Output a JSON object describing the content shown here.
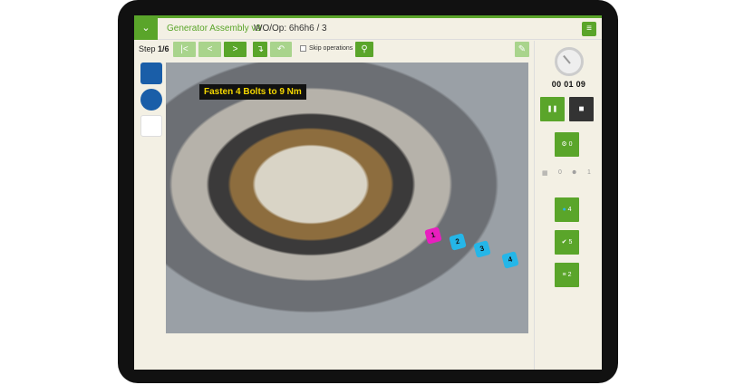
{
  "header": {
    "title": "Generator Assembly v9",
    "wo": "WO/Op: 6h6h6 / 3"
  },
  "toolbar": {
    "step_label": "Step",
    "step_value": "1/6",
    "skip_label": "Skip operations"
  },
  "instruction": "Fasten 4 Bolts to 9 Nm",
  "tags": [
    {
      "label": "1",
      "color": "#e81fbf"
    },
    {
      "label": "2",
      "color": "#25b6e8"
    },
    {
      "label": "3",
      "color": "#25b6e8"
    },
    {
      "label": "4",
      "color": "#25b6e8"
    }
  ],
  "timer": "00 01 09",
  "right": {
    "tool_count": "0",
    "parts_count": "0",
    "people_count": "1",
    "drop_count": "4",
    "check_count": "5",
    "list_count": "2"
  },
  "colors": {
    "accent": "#5aa52a",
    "stop": "#333333"
  }
}
